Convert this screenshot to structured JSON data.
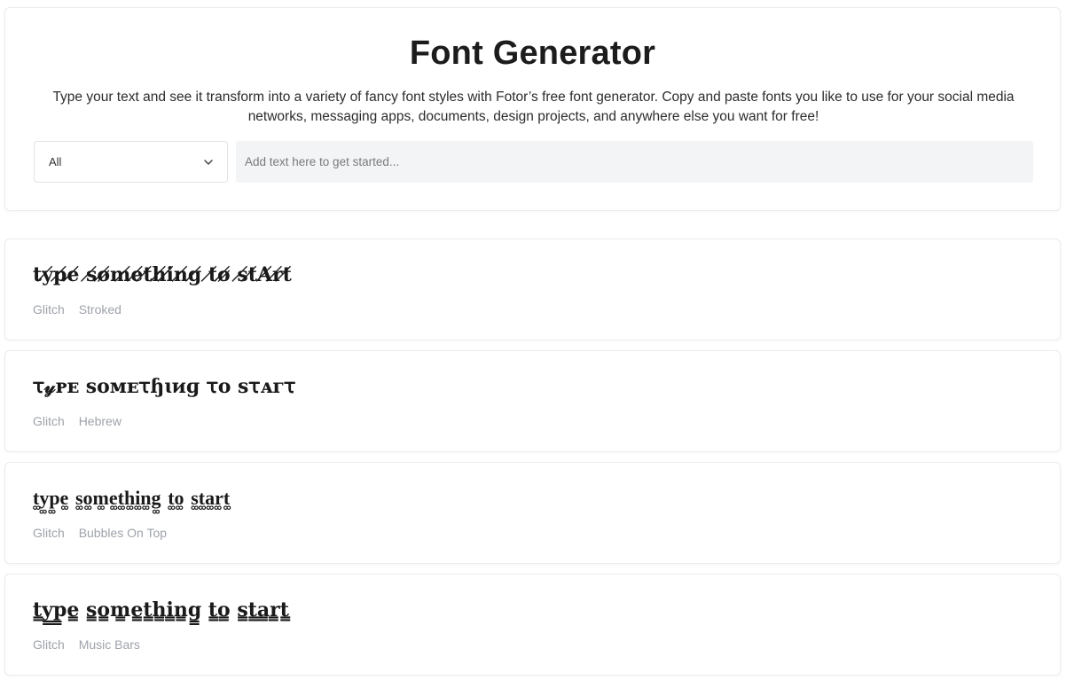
{
  "header": {
    "title": "Font Generator",
    "description": "Type your text and see it transform into a variety of fancy font styles with Fotor’s free font generator. Copy and paste fonts you like to use for your social media networks, messaging apps, documents, design projects, and anywhere else you want for free!"
  },
  "filter": {
    "selected": "All",
    "icon": "chevron-down-icon"
  },
  "search": {
    "placeholder": "Add text here to get started..."
  },
  "results": [
    {
      "sample": "ty̸p̸e̸ s̸ø̸m̸e̸t̸h̸i̸n̸g̸ t̸ø̸ s̸t̸A̸r̸t̸",
      "tags": [
        "Glitch",
        "Stroked"
      ]
    },
    {
      "sample": "ꚍ𝓎ᴩᴇ ѕᴏᴍᴇꚍɧɩᴎɡ ꚍᴏ ѕꚍᴀᴦꚍ",
      "tags": [
        "Glitch",
        "Hebrew"
      ]
    },
    {
      "sample": "t͚y͚p͚e͚ s͚o͚m͚e͚t͚h͚i͚n͚g͚ t͚o͚ s͚t͚a͚r͚t͚",
      "tags": [
        "Glitch",
        "Bubbles On Top"
      ]
    },
    {
      "sample": "t̳y̳p̳e̳ s̳o̳m̳e̳t̳h̳i̳n̳g̳ t̳o̳ s̳t̳a̳r̳t̳",
      "tags": [
        "Glitch",
        "Music Bars"
      ]
    }
  ]
}
